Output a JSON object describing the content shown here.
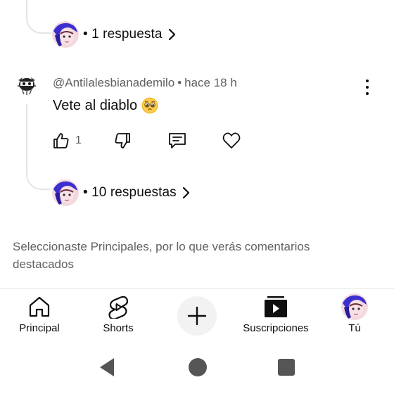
{
  "thread_top": {
    "reply_count_label": "• 1 respuesta"
  },
  "comment": {
    "author": "@Antilalesbianademilo",
    "separator": "•",
    "time": "hace 18 h",
    "text": "Vete al diablo",
    "emoji_icon": "pleading-face-icon",
    "like_count": "1",
    "reply_count_label": "• 10 respuestas"
  },
  "sort_note": "Seleccionaste Principales, por lo que verás comentarios destacados",
  "bottom_nav": {
    "home_label": "Principal",
    "shorts_label": "Shorts",
    "subscriptions_label": "Suscripciones",
    "you_label": "Tú"
  },
  "colors": {
    "text_primary": "#0f0f0f",
    "text_secondary": "#606060",
    "divider": "#e5e5e5",
    "avatar_accent": "#3b2fd0"
  }
}
